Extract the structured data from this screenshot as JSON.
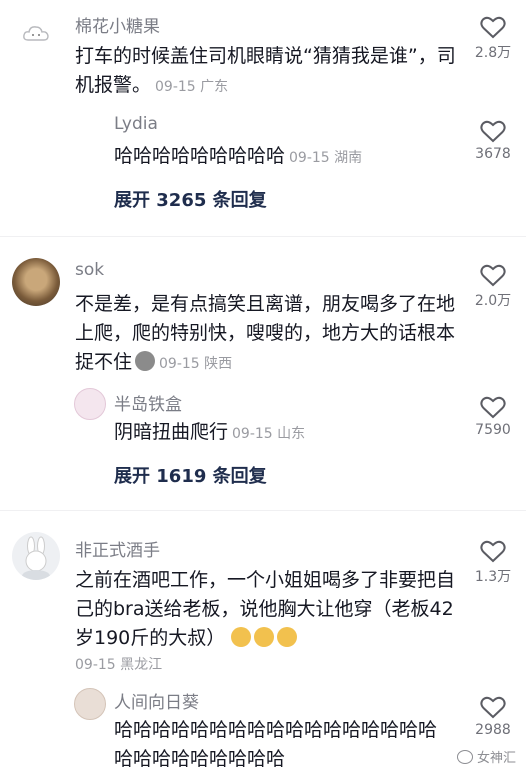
{
  "comments": [
    {
      "user": "棉花小糖果",
      "text": "打车的时候盖住司机眼睛说“猜猜我是谁”，司机报警。",
      "time": "09-15 广东",
      "likes": "2.8万",
      "reply": {
        "user": "Lydia",
        "text": "哈哈哈哈哈哈哈哈哈",
        "time": "09-15 湖南",
        "likes": "3678"
      },
      "expand": "展开 3265 条回复"
    },
    {
      "user": "sok",
      "text": "不是差，是有点搞笑且离谱，朋友喝多了在地上爬，爬的特别快，嗖嗖的，地方大的话根本捉不住",
      "time": "09-15 陕西",
      "likes": "2.0万",
      "reply": {
        "user": "半岛铁盒",
        "text": "阴暗扭曲爬行",
        "time": "09-15 山东",
        "likes": "7590"
      },
      "expand": "展开 1619 条回复"
    },
    {
      "user": "非正式酒手",
      "text": "之前在酒吧工作，一个小姐姐喝多了非要把自己的bra送给老板，说他胸大让他穿（老板42岁190斤的大叔）",
      "time": "09-15 黑龙江",
      "likes": "1.3万",
      "reply": {
        "user": "人间向日葵",
        "text": "哈哈哈哈哈哈哈哈哈哈哈哈哈哈哈哈哈哈哈哈哈哈哈哈哈哈",
        "likes": "2988"
      }
    }
  ],
  "watermark": "女神汇",
  "colors": {
    "username": "#7b7d86",
    "meta": "#9a9ba1",
    "expand": "#1f2d4d"
  }
}
